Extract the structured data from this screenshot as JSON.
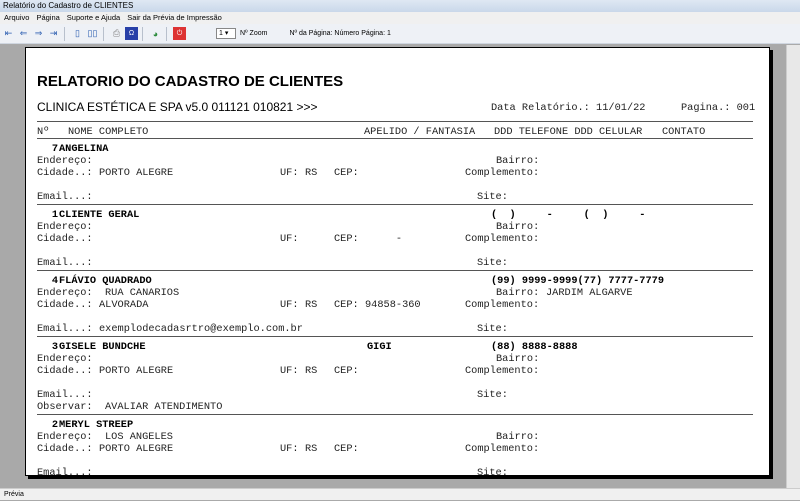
{
  "window": {
    "title": "Relatório do Cadastro de CLIENTES"
  },
  "menu": [
    "Arquivo",
    "Página",
    "Suporte e Ajuda",
    "Sair da Prévia de Impressão"
  ],
  "toolbar": {
    "zoom_value": "1",
    "zoom_label": "Nº Zoom",
    "page_label": "Nº da Página: Número Página: 1"
  },
  "status": "Prévia",
  "report": {
    "title": "RELATORIO DO CADASTRO DE CLIENTES",
    "subtitle": "CLINICA ESTÉTICA E SPA v5.0 011121 010821 >>>",
    "date": "Data Relatório.: 11/01/22",
    "page": "Pagina.: 001",
    "headers": {
      "num": "Nº",
      "name": "NOME COMPLETO",
      "apelido": "APELIDO / FANTASIA",
      "phones": "DDD TELEFONE DDD CELULAR",
      "contato": "CONTATO"
    },
    "labels": {
      "endereco": "Endereço:",
      "bairro": "Bairro:",
      "cidade": "Cidade..:",
      "uf": "UF:",
      "cep": "CEP:",
      "complemento": "Complemento:",
      "email": "Email...:",
      "site": "Site:",
      "observar": "Observar:"
    },
    "records": [
      {
        "num": "7",
        "name": "ANGELINA",
        "apelido": "",
        "phones": "",
        "endereco": "",
        "bairro": "",
        "cidade": "PORTO ALEGRE",
        "uf": "RS",
        "cep": "",
        "email": "",
        "observar": null
      },
      {
        "num": "1",
        "name": "CLIENTE GERAL",
        "apelido": "",
        "phones": "(  )     -     (  )     -",
        "endereco": "",
        "bairro": "",
        "cidade": "",
        "uf": "",
        "cep": "     -",
        "email": "",
        "observar": null
      },
      {
        "num": "4",
        "name": "FLÁVIO QUADRADO",
        "apelido": "",
        "phones": "(99) 9999-9999(77) 7777-7779",
        "endereco": "RUA CANARIOS",
        "bairro": "JARDIM ALGARVE",
        "cidade": "ALVORADA",
        "uf": "RS",
        "cep": "94858-360",
        "email": "exemplodecadasrtro@exemplo.com.br",
        "observar": null
      },
      {
        "num": "3",
        "name": "GISELE BUNDCHE",
        "apelido": "GIGI",
        "phones": "(88) 8888-8888",
        "endereco": "",
        "bairro": "",
        "cidade": "PORTO ALEGRE",
        "uf": "RS",
        "cep": "",
        "email": "",
        "observar": "AVALIAR ATENDIMENTO"
      },
      {
        "num": "2",
        "name": "MERYL STREEP",
        "apelido": "",
        "phones": "",
        "endereco": "LOS ANGELES",
        "bairro": "",
        "cidade": "PORTO ALEGRE",
        "uf": "RS",
        "cep": "",
        "email": "",
        "observar": null
      }
    ]
  }
}
